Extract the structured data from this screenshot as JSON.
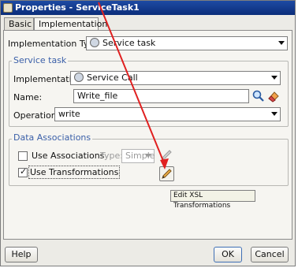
{
  "window": {
    "title": "Properties - ServiceTask1"
  },
  "tabs": [
    {
      "label": "Basic"
    },
    {
      "label": "Implementation"
    }
  ],
  "implementation_type": {
    "label": "Implementation Type:",
    "value": "Service task"
  },
  "service_task": {
    "group_title": "Service task",
    "implementation_label": "Implementation:",
    "implementation_value": "Service Call",
    "name_label": "Name:",
    "name_value": "Write_file",
    "operation_label": "Operation:",
    "operation_value": "write"
  },
  "data_associations": {
    "group_title": "Data Associations",
    "use_associations_label": "Use Associations",
    "use_associations_checked": false,
    "type_label": "Type:",
    "type_value": "Simple",
    "use_transformations_label": "Use Transformations",
    "use_transformations_checked": true,
    "tooltip": "Edit XSL Transformations"
  },
  "buttons": {
    "help": "Help",
    "ok": "OK",
    "cancel": "Cancel"
  },
  "icons": {
    "search": "search-icon",
    "clear": "eraser-icon",
    "edit": "pencil-icon"
  },
  "colors": {
    "titlebar": "#0b2d7a",
    "group_title": "#3a5fa8",
    "annotation_arrow": "#e02020"
  }
}
